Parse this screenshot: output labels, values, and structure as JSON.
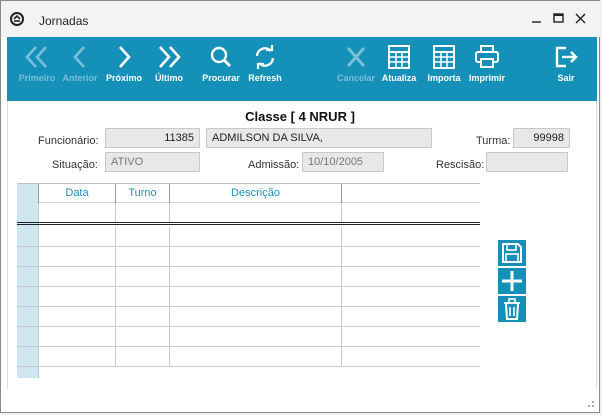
{
  "window": {
    "title": "Jornadas"
  },
  "toolbar": {
    "primeiro": "Primeiro",
    "anterior": "Anterior",
    "proximo": "Próximo",
    "ultimo": "Último",
    "procurar": "Procurar",
    "refresh": "Refresh",
    "cancelar": "Cancelar",
    "atualiza": "Atualiza",
    "importa": "Importa",
    "imprimir": "Imprimir",
    "sair": "Sair"
  },
  "form": {
    "classe": "Classe [ 4 NRUR ]",
    "funcionario_label": "Funcionário:",
    "funcionario_code": "11385",
    "funcionario_name": "ADMILSON DA SILVA,",
    "turma_label": "Turma:",
    "turma_value": "99998",
    "situacao_label": "Situação:",
    "situacao_value": "ATIVO",
    "admissao_label": "Admissão:",
    "admissao_value": "10/10/2005",
    "rescisao_label": "Rescisão:",
    "rescisao_value": ""
  },
  "grid": {
    "columns": [
      "Data",
      "Turno",
      "Descrição",
      ""
    ],
    "rows": [
      [
        "",
        "",
        "",
        ""
      ],
      [
        "",
        "",
        "",
        ""
      ],
      [
        "",
        "",
        "",
        ""
      ],
      [
        "",
        "",
        "",
        ""
      ],
      [
        "",
        "",
        "",
        ""
      ],
      [
        "",
        "",
        "",
        ""
      ],
      [
        "",
        "",
        "",
        ""
      ],
      [
        "",
        "",
        "",
        ""
      ]
    ]
  },
  "colors": {
    "toolbar": "#1590b8",
    "header_text": "#1f8fbf",
    "selector_column": "#cfe6f1"
  },
  "icons": [
    "app-icon",
    "first-icon",
    "previous-icon",
    "next-icon",
    "last-icon",
    "search-icon",
    "refresh-icon",
    "cancel-icon",
    "calculator-icon",
    "printer-icon",
    "exit-icon",
    "save-icon",
    "add-icon",
    "delete-icon"
  ]
}
